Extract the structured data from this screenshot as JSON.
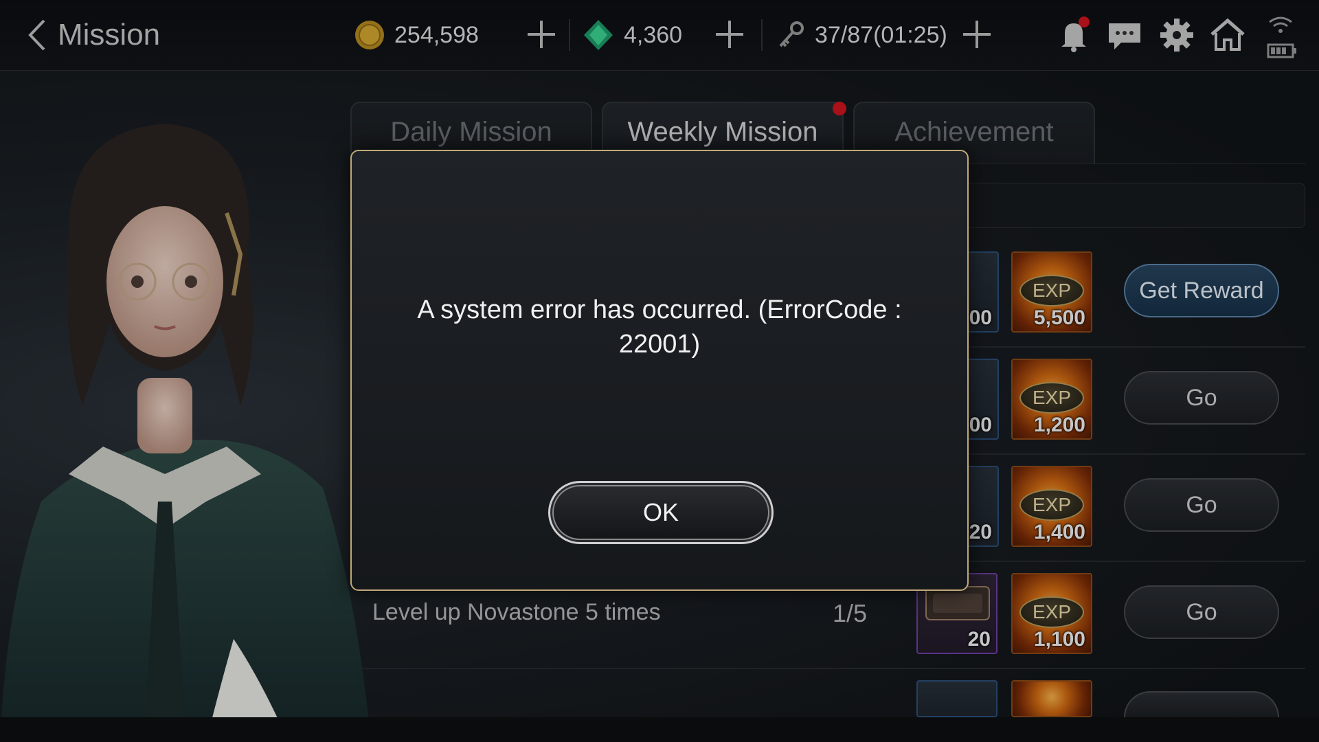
{
  "header": {
    "back_label": "Mission",
    "gold": "254,598",
    "gems": "4,360",
    "stamina": "37/87(01:25)"
  },
  "tabs": [
    {
      "label": "Daily Mission"
    },
    {
      "label": "Weekly Mission"
    },
    {
      "label": "Achievement"
    }
  ],
  "rows": [
    {
      "item_amount": "00",
      "exp_label": "EXP",
      "exp_amount": "5,500",
      "button": "Get Reward"
    },
    {
      "item_amount": "00",
      "exp_label": "EXP",
      "exp_amount": "1,200",
      "button": "Go"
    },
    {
      "item_amount": "20",
      "exp_label": "EXP",
      "exp_amount": "1,400",
      "button": "Go"
    },
    {
      "mission": "Level up Novastone 5 times",
      "progress": "1/5",
      "item_amount": "20",
      "exp_label": "EXP",
      "exp_amount": "1,100",
      "button": "Go"
    }
  ],
  "dialog": {
    "message": "A system error has occurred. (ErrorCode : 22001)",
    "ok_label": "OK"
  },
  "colors": {
    "accent_gold": "#bfa978",
    "notification_red": "#d0141d",
    "reward_button": "#27445e"
  },
  "icons": [
    "chevron-left-icon",
    "gold-coin-icon",
    "green-gem-icon",
    "plus-icon",
    "stamina-key-icon",
    "bell-icon",
    "chat-icon",
    "gear-icon",
    "home-icon",
    "wifi-icon",
    "battery-icon"
  ]
}
